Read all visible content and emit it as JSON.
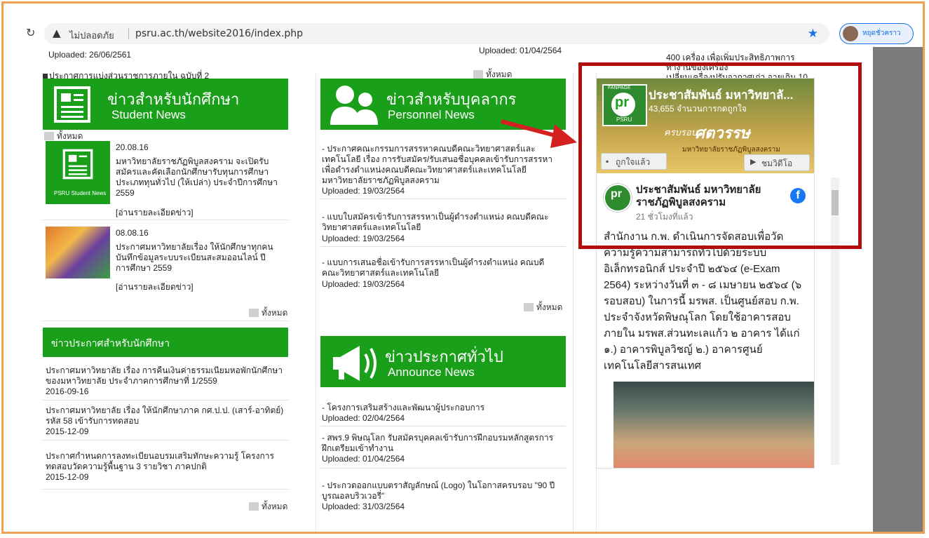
{
  "browser": {
    "security_label": "ไม่ปลอดภัย",
    "url": "psru.ac.th/website2016/index.php",
    "profile_label": "หยุดชั่วคราว"
  },
  "top": {
    "uploaded_left": "Uploaded: 26/06/2561",
    "uploaded_mid": "Uploaded: 01/04/2564",
    "announcement_link": "ประกาศการแบ่งส่วนราชการภายใน ฉบับที่ 2",
    "mid_more": "ทั้งหมด",
    "right_line1": "400  เครื่อง  เพื่อเพิ่มประสิทธิภาพการ",
    "right_line2": "ทำงานของเครื่อง",
    "right_line3": "เปลี่ยนเครื่องปรับอากาศเก่า  อายุเกิน  10"
  },
  "student_news": {
    "title": "ข่าวสำหรับนักศึกษา",
    "subtitle": "Student News",
    "more_top": "ทั้งหมด",
    "items": [
      {
        "date": "20.08.16",
        "text": "มหาวิทยาลัยราชภัฏพิบูลสงคราม จะเปิดรับสมัครและคัดเลือกนักศึกษารับทุนการศึกษาประเภททุนทั่วไป (ให้เปล่า) ประจำปีการศึกษา 2559",
        "read_more": "[อ่านรายละเอียดข่าว]",
        "thumb_caption": "PSRU Student News"
      },
      {
        "date": "08.08.16",
        "text": "ประกาศมหาวิทยาลัยเรื่อง ให้นักศึกษาทุกคนบันทึกข้อมูลระบบระเบียนสะสมออนไลน์ ปีการศึกษา 2559",
        "read_more": "[อ่านรายละเอียดข่าว]"
      }
    ],
    "more_bottom": "ทั้งหมด"
  },
  "student_announce": {
    "title": "ข่าวประกาศสำหรับนักศึกษา",
    "items": [
      {
        "text": "ประกาศมหาวิทยาลัย เรื่อง การคืนเงินค่าธรรมเนียมหอพักนักศึกษาของมหาวิทยาลัย ประจำภาคการศึกษาที่ 1/2559",
        "date": "2016-09-16"
      },
      {
        "text": "ประกาศมหาวิทยาลัย เรื่อง ให้นักศึกษาภาค กศ.ป.ป. (เสาร์-อาทิตย์) รหัส 58 เข้ารับการทดสอบ",
        "date": "2015-12-09"
      },
      {
        "text": "ประกาศกำหนดการลงทะเบียนอบรมเสริมทักษะความรู้ โครงการทดสอบวัดความรู้พื้นฐาน 3 รายวิชา ภาคปกติ",
        "date": "2015-12-09"
      }
    ],
    "more": "ทั้งหมด"
  },
  "personnel_news": {
    "title": "ข่าวสำหรับบุคลากร",
    "subtitle": "Personnel News",
    "items": [
      {
        "text": "- ประกาศคณะกรรมการสรรหาคณบดีคณะวิทยาศาสตร์และเทคโนโลยี เรื่อง การรับสมัคร/รับเสนอชื่อบุคคลเข้ารับการสรรหาเพื่อดำรงตำแหน่งคณบดีคณะวิทยาศาสตร์และเทคโนโลยี มหาวิทยาลัยราชภัฏพิบูลสงคราม",
        "date": "Uploaded: 19/03/2564"
      },
      {
        "text": "- แบบใบสมัครเข้ารับการสรรหาเป็นผู้ดำรงตำแหน่ง คณบดีคณะวิทยาศาสตร์และเทคโนโลยี",
        "date": "Uploaded: 19/03/2564"
      },
      {
        "text": "- แบบการเสนอชื่อเข้ารับการสรรหาเป็นผู้ดำรงตำแหน่ง คณบดีคณะวิทยาศาสตร์และเทคโนโลยี",
        "date": "Uploaded: 19/03/2564"
      }
    ],
    "more": "ทั้งหมด"
  },
  "announce_news": {
    "title": "ข่าวประกาศทั่วไป",
    "subtitle": "Announce News",
    "items": [
      {
        "text": "- โครงการเสริมสร้างและพัฒนาผู้ประกอบการ",
        "date": "Uploaded: 02/04/2564"
      },
      {
        "text": "- สพร.9 พิษณุโลก รับสมัครบุคคลเข้ารับการฝึกอบรมหลักสูตรการฝึกเตรียมเข้าทำงาน",
        "date": "Uploaded: 01/04/2564"
      },
      {
        "text": "- ประกวดออกแบบตราสัญลักษณ์ (Logo) ในโอกาสครบรอบ \"90 ปี บูรณอลบริวเวอรี่\"",
        "date": "Uploaded: 31/03/2564"
      }
    ]
  },
  "facebook": {
    "page_name_short": "ประชาสัมพันธ์ มหาวิทยาลั...",
    "likes": "43,655 จำนวนการกดถูกใจ",
    "badge_top": "FANPAGE",
    "logo_text": "pr",
    "logo_bottom": "PSRU",
    "cover_text1": "ครบรอบ",
    "cover_text2": "ศตวรรษ",
    "cover_text3": "มหาวิทยาลัยราชภัฏพิบูลสงคราม",
    "like_button": "ถูกใจแล้ว",
    "video_button": "ชมวิดีโอ",
    "post_author": "ประชาสัมพันธ์ มหาวิทยาลัย ราชภัฏพิบูลสงคราม",
    "post_time": "21 ชั่วโมงที่แล้ว",
    "post_text": "สำนักงาน ก.พ. ดำเนินการจัดสอบเพื่อวัดความรู้ความสามารถทั่วไปด้วยระบบอิเล็กทรอนิกส์ ประจำปี ๒๕๖๔ (e-Exam 2564) ระหว่างวันที่ ๓ - ๘ เมษายน ๒๕๖๔ (๖ รอบสอบ) ในการนี้ มรพส. เป็นศูนย์สอบ ก.พ. ประจำจังหวัดพิษณุโลก โดยใช้อาคารสอบภายใน มรพส.ส่วนทะเลแก้ว ๒ อาคาร ได้แก่ ๑.) อาคารพิบูลวิชญ์ ๒.) อาคารศูนย์เทคโนโลยีสารสนเทศ"
  },
  "colors": {
    "green": "#1a9f1a",
    "red_highlight": "#b00d0d",
    "frame": "#f0a050",
    "facebook_blue": "#1877f2"
  }
}
